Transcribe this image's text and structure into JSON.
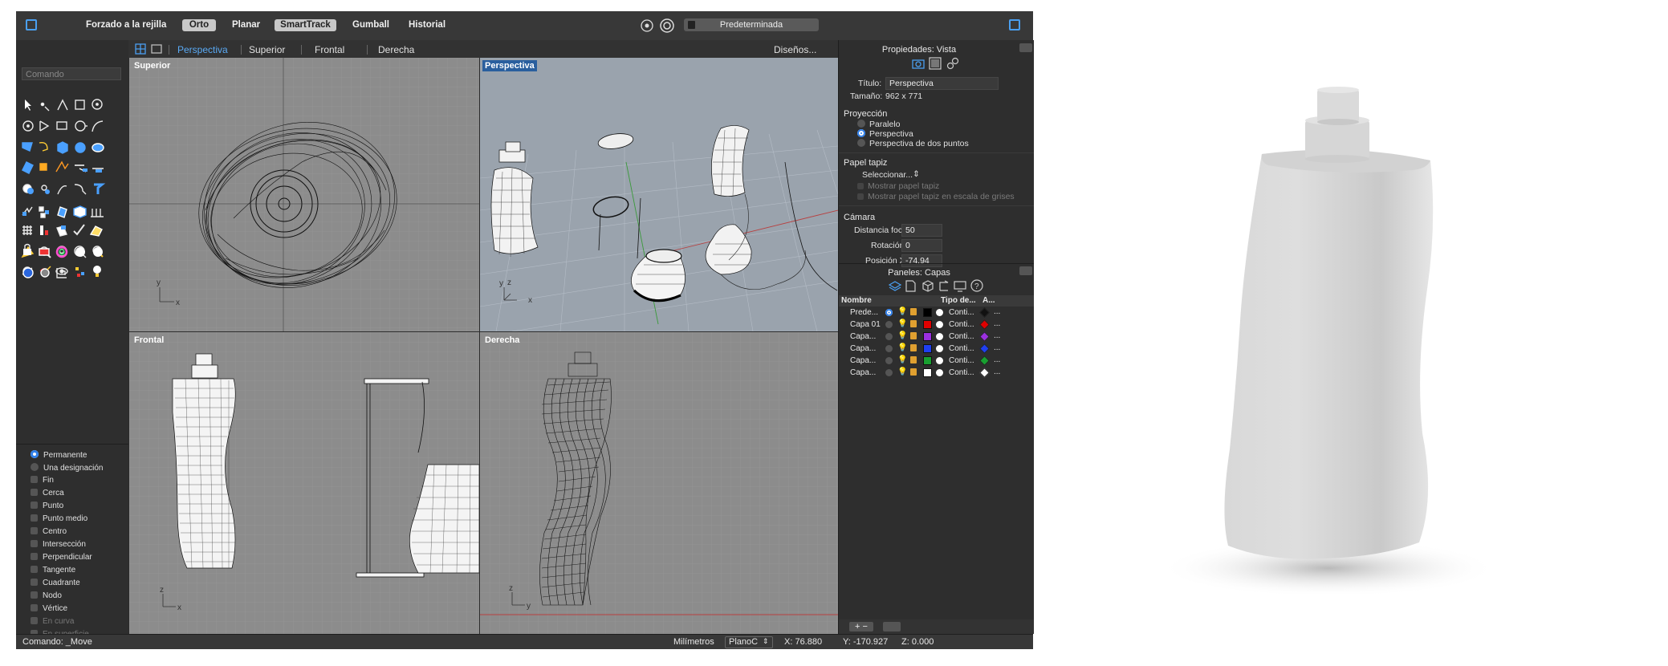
{
  "toolbar": {
    "items": [
      "Forzado a la rejilla",
      "Orto",
      "Planar",
      "SmartTrack",
      "Gumball",
      "Historial"
    ],
    "display_mode": "Predeterminada"
  },
  "tabs": [
    "Perspectiva",
    "Superior",
    "Frontal",
    "Derecha"
  ],
  "layouts_label": "Diseños...",
  "command": {
    "placeholder": "Comando",
    "status_prompt": "Comando: _Move"
  },
  "viewports": {
    "top": "Superior",
    "perspective": "Perspectiva",
    "front": "Frontal",
    "right": "Derecha"
  },
  "axes": {
    "x": "x",
    "y": "y",
    "z": "z"
  },
  "osnap": {
    "modes": [
      "Permanente",
      "Una designación"
    ],
    "items": [
      "Fin",
      "Cerca",
      "Punto",
      "Punto medio",
      "Centro",
      "Intersección",
      "Perpendicular",
      "Tangente",
      "Cuadrante",
      "Nodo",
      "Vértice",
      "En curva",
      "En superficie"
    ]
  },
  "properties": {
    "header": "Propiedades: Vista",
    "title_label": "Título:",
    "title_value": "Perspectiva",
    "size_label": "Tamaño:",
    "size_value": "962 x 771",
    "projection_label": "Proyección",
    "projection_options": [
      "Paralelo",
      "Perspectiva",
      "Perspectiva de dos puntos"
    ],
    "wallpaper_label": "Papel tapiz",
    "wallpaper_select": "Seleccionar...",
    "show_wallpaper": "Mostrar papel tapiz",
    "wallpaper_grey": "Mostrar papel tapiz en escala de grises",
    "camera_label": "Cámara",
    "focal_label": "Distancia focal:",
    "focal_value": "50",
    "rotation_label": "Rotación:",
    "rotation_value": "0",
    "posx_label": "Posición X:",
    "posx_value": "-74.94"
  },
  "layers": {
    "header": "Paneles: Capas",
    "col_name": "Nombre",
    "col_linetype": "Tipo de...",
    "col_a": "A...",
    "rows": [
      {
        "name": "Prede...",
        "color": "#000000",
        "linetype": "Conti...",
        "print": "#111111"
      },
      {
        "name": "Capa 01",
        "color": "#e00000",
        "linetype": "Conti...",
        "print": "#e00000"
      },
      {
        "name": "Capa...",
        "color": "#9b30e0",
        "linetype": "Conti...",
        "print": "#9b30e0"
      },
      {
        "name": "Capa...",
        "color": "#1f3ff0",
        "linetype": "Conti...",
        "print": "#1f3ff0"
      },
      {
        "name": "Capa...",
        "color": "#18a030",
        "linetype": "Conti...",
        "print": "#18a030"
      },
      {
        "name": "Capa...",
        "color": "#ffffff",
        "linetype": "Conti...",
        "print": "#ffffff"
      }
    ]
  },
  "statusbar": {
    "units": "Milímetros",
    "cplane": "PlanoC",
    "x": "X: 76.880",
    "y": "Y: -170.927",
    "z": "Z: 0.000"
  }
}
